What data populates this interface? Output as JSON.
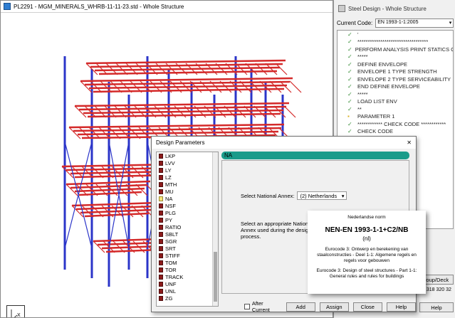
{
  "structure_window": {
    "title": "PL2291 - MGM_MINERALS_WHRB-11-11-23.std - Whole Structure",
    "axis_label": "X"
  },
  "steel_panel": {
    "title": "Steel Design - Whole Structure",
    "code_label": "Current Code:",
    "code_value": "EN 1993-1-1:2005",
    "commands": [
      {
        "text": "'",
        "checked": true
      },
      {
        "text": "**********************************",
        "checked": true
      },
      {
        "text": "PERFORM ANALYSIS PRINT STATICS C",
        "checked": true
      },
      {
        "text": "*****",
        "checked": true
      },
      {
        "text": "DEFINE ENVELOPE",
        "checked": true
      },
      {
        "text": "ENVELOPE 1 TYPE STRENGTH",
        "checked": true
      },
      {
        "text": "ENVELOPE 2 TYPE SERVICEABILITY",
        "checked": true
      },
      {
        "text": "END DEFINE ENVELOPE",
        "checked": true
      },
      {
        "text": "*****",
        "checked": true
      },
      {
        "text": "LOAD LIST ENV",
        "checked": true
      },
      {
        "text": "**",
        "checked": true
      },
      {
        "text": "PARAMETER 1",
        "checked": false,
        "folder": true
      },
      {
        "text": "************ CHECK CODE ************",
        "checked": true
      },
      {
        "text": "CHECK CODE",
        "checked": true
      }
    ],
    "group_button": "roup/Deck",
    "number_text": "6 318 320 32",
    "help_button": "Help"
  },
  "dialog": {
    "title": "Design Parameters",
    "close": "✕",
    "params": [
      "LKP",
      "LVV",
      "LY",
      "LZ",
      "MTH",
      "MU",
      "NA",
      "NSF",
      "PLG",
      "PY",
      "RATIO",
      "SBLT",
      "SGR",
      "SRT",
      "STIFF",
      "TOM",
      "TOR",
      "TRACK",
      "UNF",
      "UNL",
      "ZG"
    ],
    "selected_param": "NA",
    "header": "NA",
    "annex_label": "Select National Annex:",
    "annex_value": "(2) Netherlands",
    "desc": "Select an appropriate National Annex used during the design process.",
    "after_current": "After Current",
    "buttons": {
      "add": "Add",
      "assign": "Assign",
      "close": "Close",
      "help": "Help"
    }
  },
  "card": {
    "line1": "Nederlandse norm",
    "line2": "NEN-EN 1993-1-1+C2/NB",
    "line3": "(nl)",
    "line4": "Eurocode 3: Ontwerp en berekening van staalconstructies - Deel 1-1: Algemene regels en regels voor gebouwen",
    "line5": "Eurocode 3: Design of steel structures - Part 1-1: General rules and rules for buildings"
  },
  "colors": {
    "beam": "#d42a2a",
    "column": "#2b35c9",
    "na_header": "#1a9b8a",
    "param_icon": "#8b1a1a"
  }
}
